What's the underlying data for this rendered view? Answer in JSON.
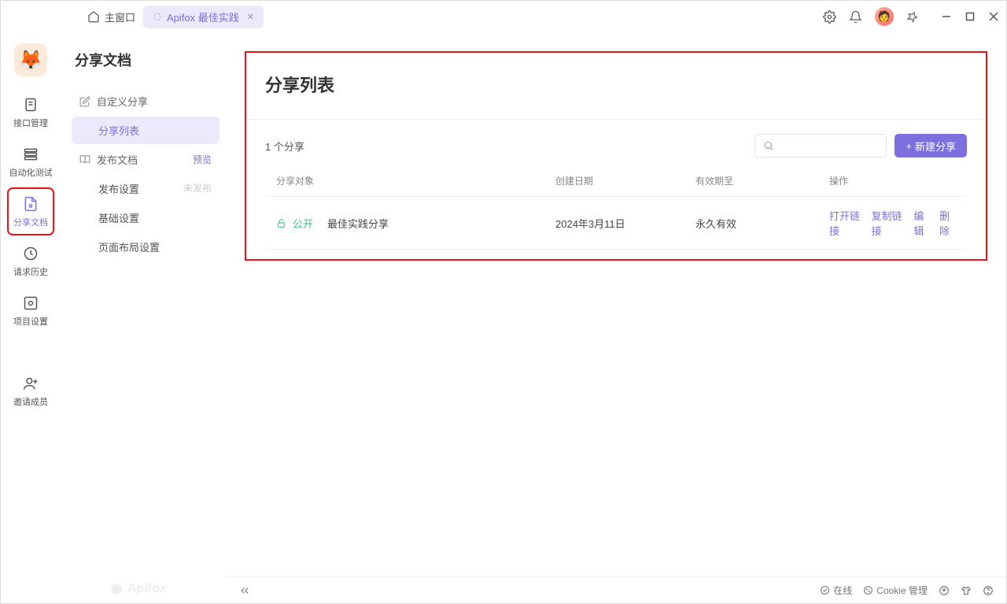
{
  "titlebar": {
    "home_label": "主窗口",
    "tab_label": "Apifox 最佳实践"
  },
  "leftnav": {
    "items": [
      {
        "label": "接口管理"
      },
      {
        "label": "自动化测试"
      },
      {
        "label": "分享文档"
      },
      {
        "label": "请求历史"
      },
      {
        "label": "项目设置"
      }
    ],
    "invite_label": "邀请成员"
  },
  "subsidebar": {
    "title": "分享文档",
    "groups": {
      "custom_share": "自定义分享",
      "share_list": "分享列表",
      "publish_docs": "发布文档",
      "preview": "预览",
      "publish_settings": "发布设置",
      "unpublished": "未发布",
      "basic_settings": "基础设置",
      "page_layout_settings": "页面布局设置"
    }
  },
  "content": {
    "page_title": "分享列表",
    "share_count": "1 个分享",
    "new_share_label": "新建分享",
    "columns": {
      "target": "分享对象",
      "created": "创建日期",
      "valid_until": "有效期至",
      "actions": "操作"
    },
    "rows": [
      {
        "public_label": "公开",
        "name": "最佳实践分享",
        "created": "2024年3月11日",
        "valid_until": "永久有效",
        "actions": {
          "open": "打开链接",
          "copy": "复制链接",
          "edit": "编辑",
          "delete": "删除"
        }
      }
    ]
  },
  "footer": {
    "online": "在线",
    "cookie": "Cookie 管理",
    "watermark": "Apifox"
  }
}
